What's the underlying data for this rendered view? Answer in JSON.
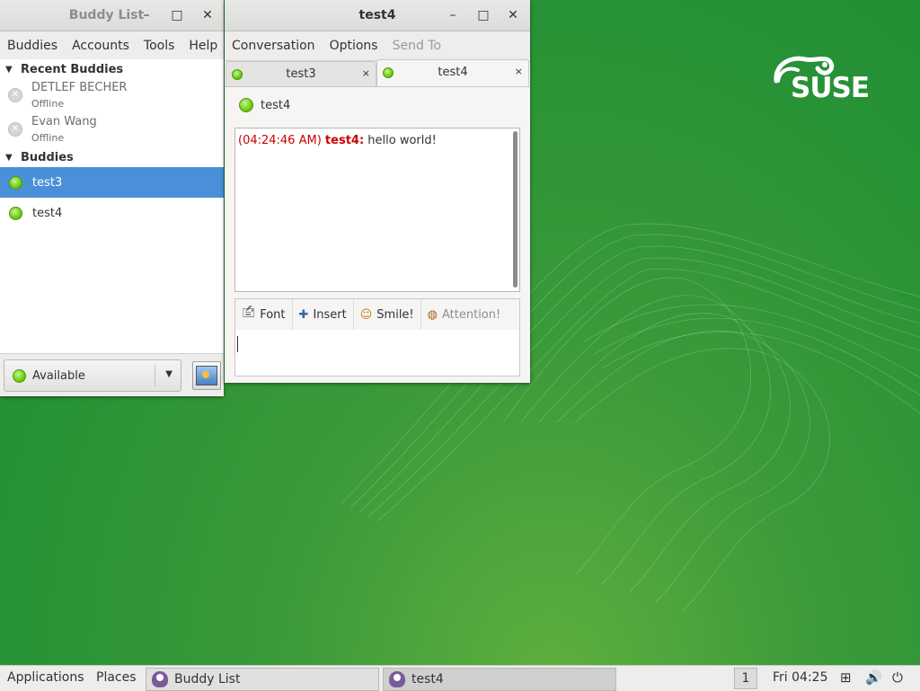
{
  "desktop": {
    "logo_text": "SUSE"
  },
  "buddy_window": {
    "title": "Buddy List",
    "controls": {
      "minimize": "–",
      "maximize": "□",
      "close": "✕"
    },
    "menu": [
      "Buddies",
      "Accounts",
      "Tools",
      "Help"
    ],
    "groups": [
      {
        "name": "Recent Buddies",
        "buddies": [
          {
            "name": "DETLEF BECHER",
            "status": "Offline"
          },
          {
            "name": "Evan Wang",
            "status": "Offline"
          }
        ]
      },
      {
        "name": "Buddies",
        "buddies": [
          {
            "name": "test3",
            "selected": true
          },
          {
            "name": "test4",
            "selected": false
          }
        ]
      }
    ],
    "status_select": "Available"
  },
  "conv_window": {
    "title": "test4",
    "controls": {
      "minimize": "–",
      "maximize": "□",
      "close": "✕"
    },
    "menu": [
      "Conversation",
      "Options",
      "Send To"
    ],
    "tabs": [
      {
        "label": "test3",
        "close": "×",
        "active": false
      },
      {
        "label": "test4",
        "close": "×",
        "active": true
      }
    ],
    "contact": "test4",
    "messages": [
      {
        "time": "(04:24:46 AM)",
        "sender": "test4:",
        "text": "hello world!"
      }
    ],
    "format_buttons": [
      {
        "label": "Font",
        "icon": "font-icon"
      },
      {
        "label": "Insert",
        "icon": "plus-icon"
      },
      {
        "label": "Smile!",
        "icon": "smiley-icon"
      },
      {
        "label": "Attention!",
        "icon": "attention-icon"
      }
    ]
  },
  "panel": {
    "applications": "Applications",
    "places": "Places",
    "tasks": [
      {
        "label": "Buddy List",
        "icon": "pidgin-icon"
      },
      {
        "label": "test4",
        "icon": "pidgin-icon"
      }
    ],
    "workspace": "1",
    "clock": "Fri 04:25"
  },
  "colors": {
    "selection": "#4a90d9",
    "timestamp": "#cc0000",
    "desktop_green": "#279236"
  }
}
